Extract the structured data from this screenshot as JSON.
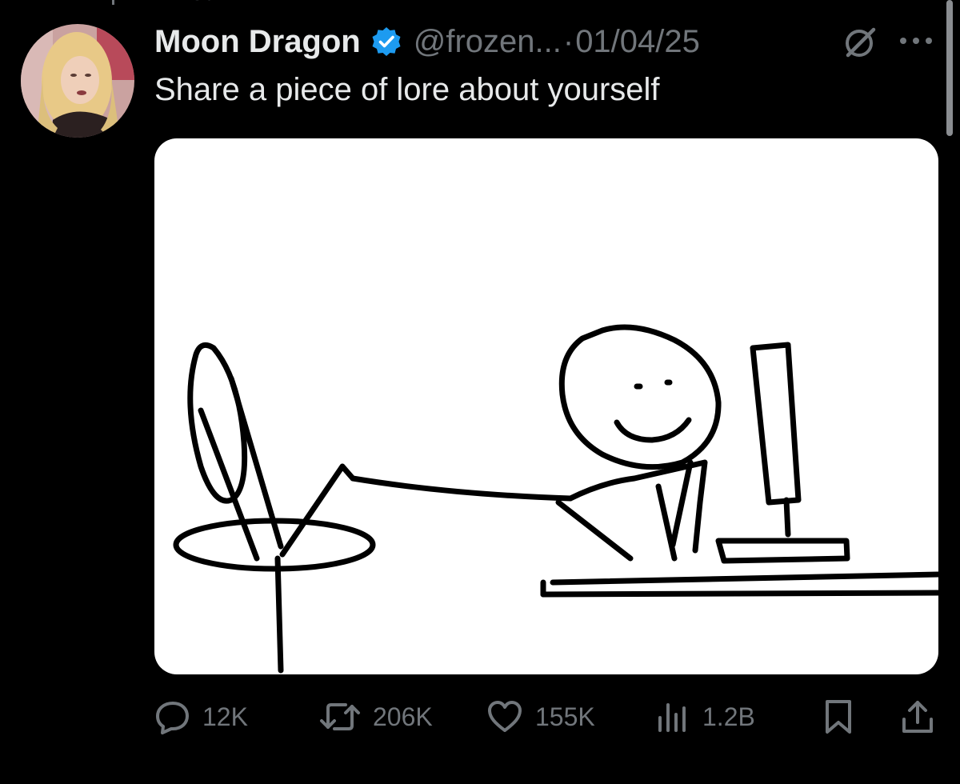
{
  "tweet": {
    "author_name": "Moon Dragon",
    "verified": true,
    "handle": "@frozen...",
    "separator": "·",
    "date": "01/04/25",
    "text": "Share a piece of lore about yourself",
    "pinned_label": "Pinned"
  },
  "media": {
    "icon": "stick-figure-drawing"
  },
  "actions": {
    "reply_count": "12K",
    "repost_count": "206K",
    "like_count": "155K",
    "view_count": "1.2B"
  },
  "colors": {
    "background": "#000000",
    "primary_text": "#e7e9ea",
    "secondary_text": "#71767b",
    "verified_badge": "#1d9bf0"
  }
}
